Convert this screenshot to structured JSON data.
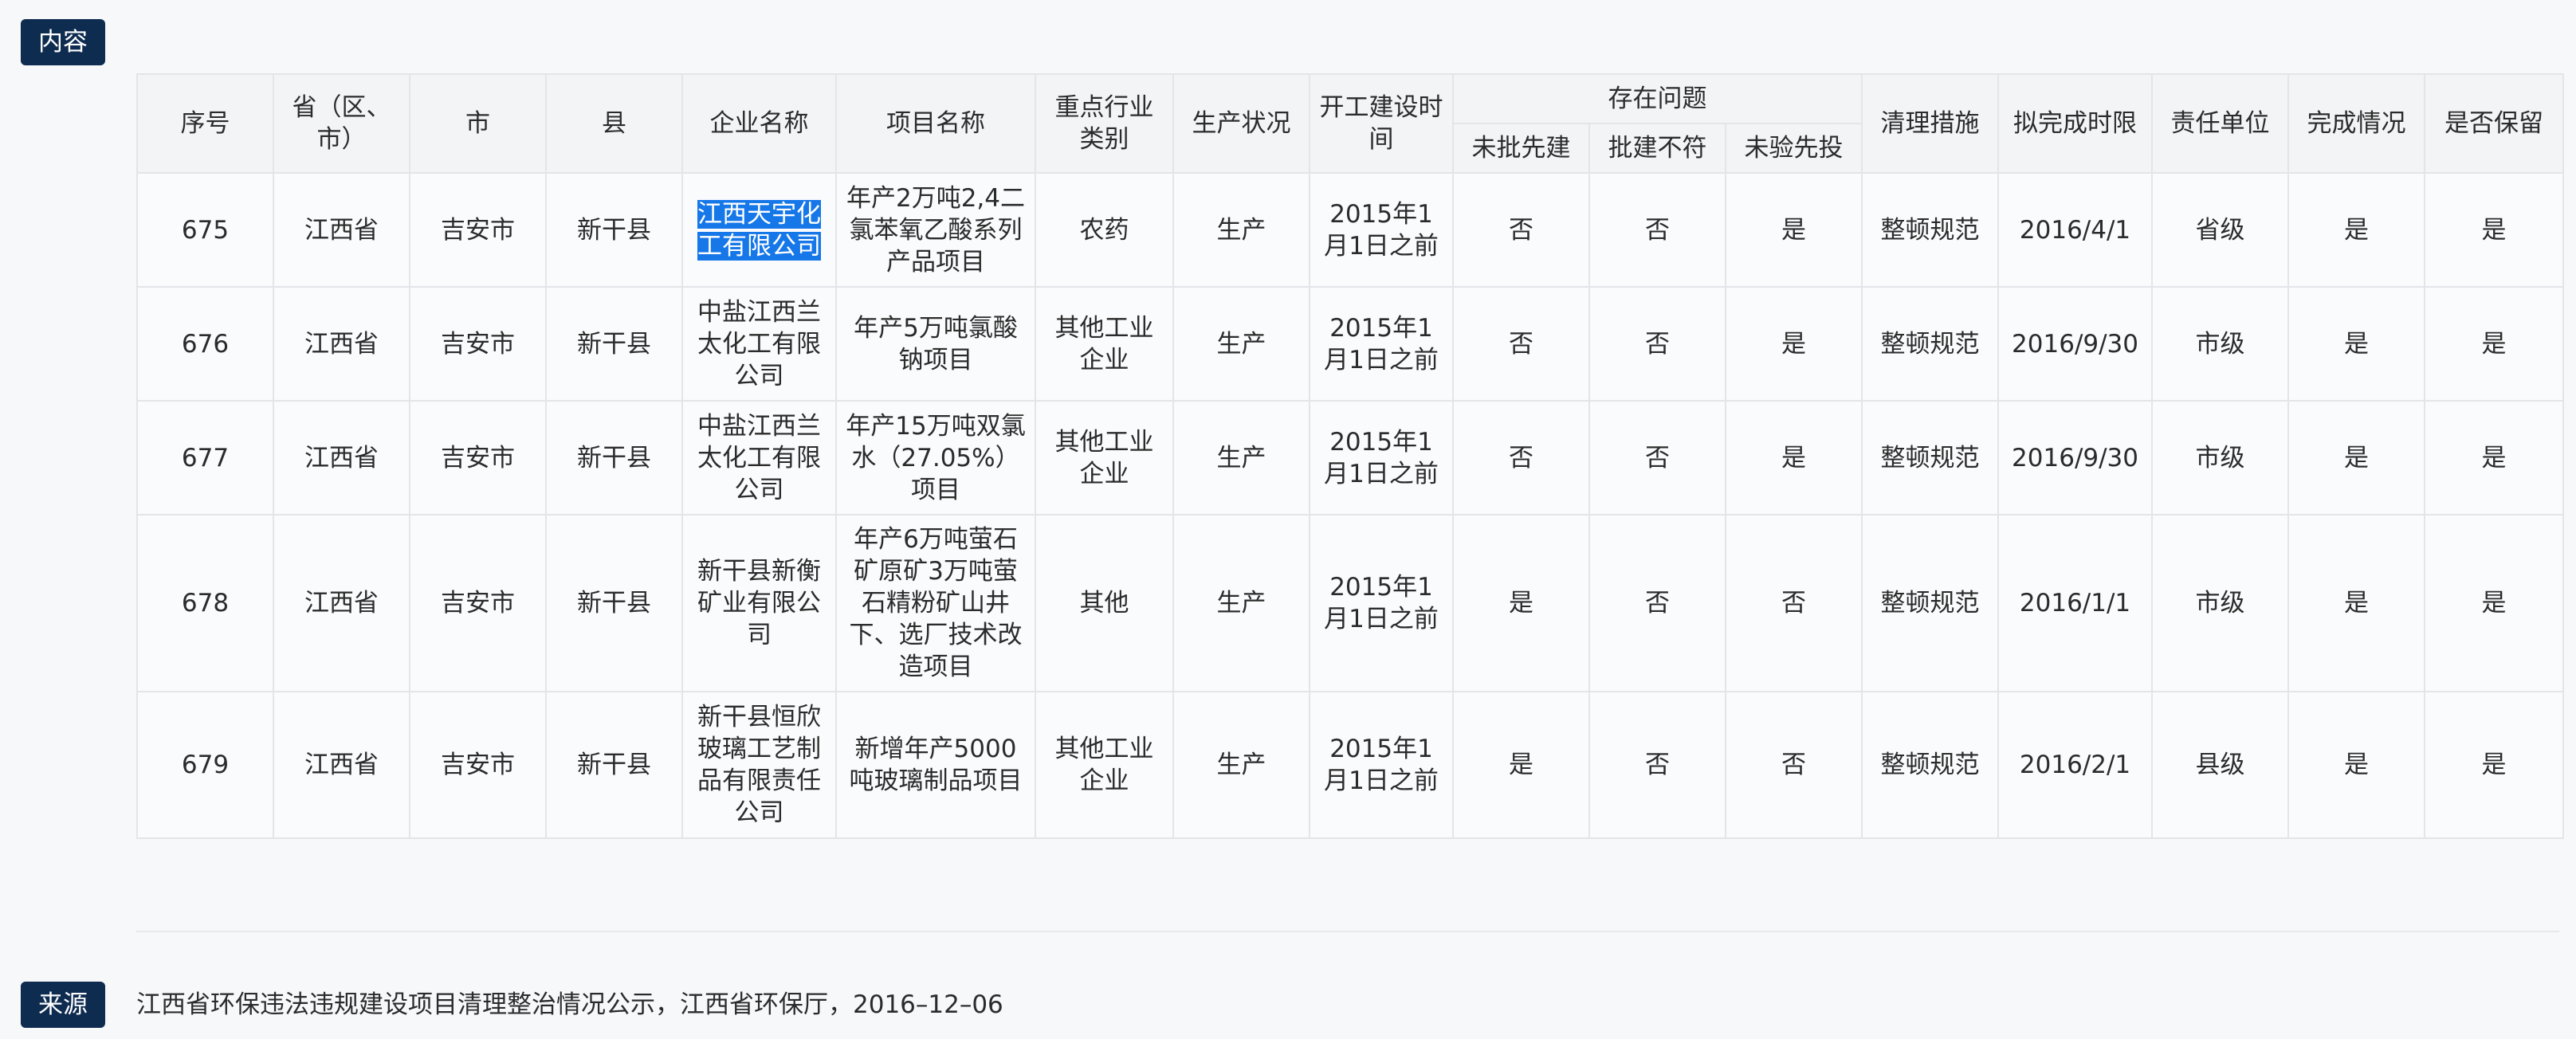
{
  "labels": {
    "content_tag": "内容",
    "source_tag": "来源"
  },
  "table": {
    "headers": {
      "seq": "序号",
      "province": "省（区、市）",
      "city": "市",
      "county": "县",
      "company": "企业名称",
      "project": "项目名称",
      "industry": "重点行业类别",
      "production": "生产状况",
      "start_time": "开工建设时间",
      "issues_group": "存在问题",
      "issue_unapproved": "未批先建",
      "issue_mismatch": "批建不符",
      "issue_unaccepted": "未验先投",
      "measure": "清理措施",
      "deadline": "拟完成时限",
      "responsible": "责任单位",
      "completion": "完成情况",
      "retain": "是否保留"
    },
    "rows": [
      {
        "seq": "675",
        "province": "江西省",
        "city": "吉安市",
        "county": "新干县",
        "company": "江西天宇化工有限公司",
        "project": "年产2万吨2,4二氯苯氧乙酸系列产品项目",
        "industry": "农药",
        "production": "生产",
        "start_time": "2015年1月1日之前",
        "unapproved": "否",
        "mismatch": "否",
        "unaccepted": "是",
        "measure": "整顿规范",
        "deadline": "2016/4/1",
        "responsible": "省级",
        "completion": "是",
        "retain": "是"
      },
      {
        "seq": "676",
        "province": "江西省",
        "city": "吉安市",
        "county": "新干县",
        "company": "中盐江西兰太化工有限公司",
        "project": "年产5万吨氯酸钠项目",
        "industry": "其他工业企业",
        "production": "生产",
        "start_time": "2015年1月1日之前",
        "unapproved": "否",
        "mismatch": "否",
        "unaccepted": "是",
        "measure": "整顿规范",
        "deadline": "2016/9/30",
        "responsible": "市级",
        "completion": "是",
        "retain": "是"
      },
      {
        "seq": "677",
        "province": "江西省",
        "city": "吉安市",
        "county": "新干县",
        "company": "中盐江西兰太化工有限公司",
        "project": "年产15万吨双氯水（27.05%）项目",
        "industry": "其他工业企业",
        "production": "生产",
        "start_time": "2015年1月1日之前",
        "unapproved": "否",
        "mismatch": "否",
        "unaccepted": "是",
        "measure": "整顿规范",
        "deadline": "2016/9/30",
        "responsible": "市级",
        "completion": "是",
        "retain": "是"
      },
      {
        "seq": "678",
        "province": "江西省",
        "city": "吉安市",
        "county": "新干县",
        "company": "新干县新衡矿业有限公司",
        "project": "年产6万吨萤石矿原矿3万吨萤石精粉矿山井下、选厂技术改造项目",
        "industry": "其他",
        "production": "生产",
        "start_time": "2015年1月1日之前",
        "unapproved": "是",
        "mismatch": "否",
        "unaccepted": "否",
        "measure": "整顿规范",
        "deadline": "2016/1/1",
        "responsible": "市级",
        "completion": "是",
        "retain": "是"
      },
      {
        "seq": "679",
        "province": "江西省",
        "city": "吉安市",
        "county": "新干县",
        "company": "新干县恒欣玻璃工艺制品有限责任公司",
        "project": "新增年产5000吨玻璃制品项目",
        "industry": "其他工业企业",
        "production": "生产",
        "start_time": "2015年1月1日之前",
        "unapproved": "是",
        "mismatch": "否",
        "unaccepted": "否",
        "measure": "整顿规范",
        "deadline": "2016/2/1",
        "responsible": "县级",
        "completion": "是",
        "retain": "是"
      }
    ]
  },
  "source": {
    "text": "江西省环保违法违规建设项目清理整治情况公示，江西省环保厅，2016–12–06"
  },
  "colors": {
    "tag_background": "#0e2b50",
    "selection_highlight": "#1677e8"
  }
}
